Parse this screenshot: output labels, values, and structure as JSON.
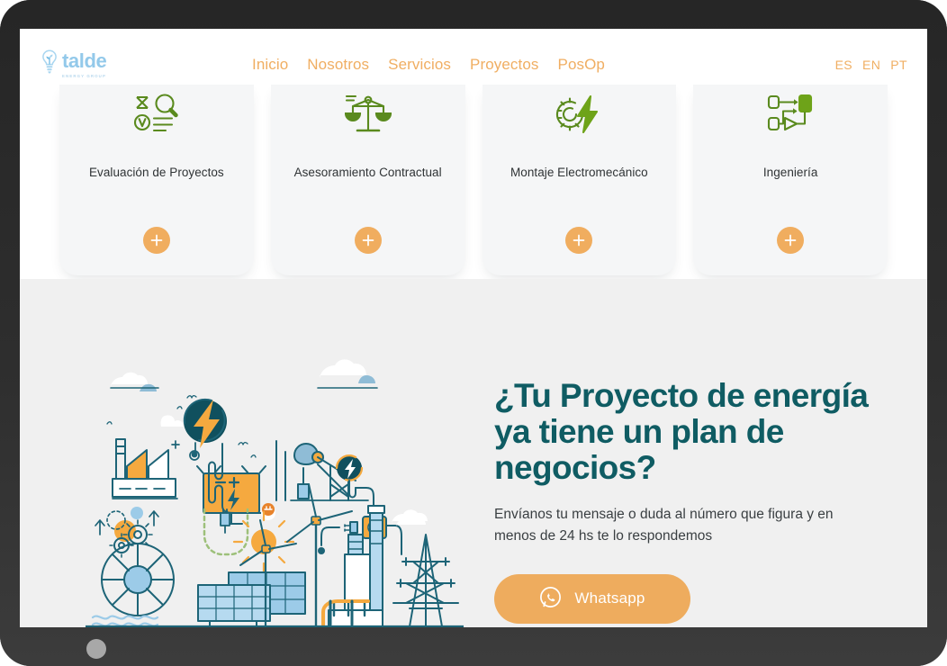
{
  "device": {
    "home_button_name": "home-button",
    "frame_color": "#2e2e2e"
  },
  "header": {
    "logo": {
      "word": "talde",
      "tagline": "ENERGY GROUP",
      "icon": "lightbulb-plant-icon",
      "color": "#93c9ea"
    },
    "nav": [
      {
        "label": "Inicio"
      },
      {
        "label": "Nosotros"
      },
      {
        "label": "Servicios"
      },
      {
        "label": "Proyectos"
      },
      {
        "label": "PosOp"
      }
    ],
    "nav_color": "#f0ae62",
    "languages": [
      {
        "label": "ES"
      },
      {
        "label": "EN"
      },
      {
        "label": "PT"
      }
    ]
  },
  "services": {
    "card_bg": "#f5f6f7",
    "icon_color": "#5a8a1e",
    "plus_color": "#f0ad5f",
    "cards": [
      {
        "title": "Evaluación de Proyectos",
        "icon": "magnifier-checklist-icon",
        "expand_label": "+"
      },
      {
        "title": "Asesoramiento Contractual",
        "icon": "balance-scales-icon",
        "expand_label": "+"
      },
      {
        "title": "Montaje Electromecánico",
        "icon": "gear-bolt-icon",
        "expand_label": "+"
      },
      {
        "title": "Ingeniería",
        "icon": "flowchart-icon",
        "expand_label": "+"
      }
    ]
  },
  "cta": {
    "background": "#f0f0f0",
    "heading": "¿Tu Proyecto de energía ya tiene un plan de negocios?",
    "heading_color": "#0f5c63",
    "subtitle": "Envíanos tu mensaje o duda al número que figura y en menos de 24 hs te lo respondemos",
    "button": {
      "label": "Whatsapp",
      "icon": "whatsapp-icon",
      "color": "#eeac5e"
    },
    "illustration": {
      "name": "energy-infrastructure-illustration",
      "stroke_color": "#1d6477",
      "accent_orange": "#f5a93f",
      "accent_blue": "#9ccbe8"
    }
  }
}
